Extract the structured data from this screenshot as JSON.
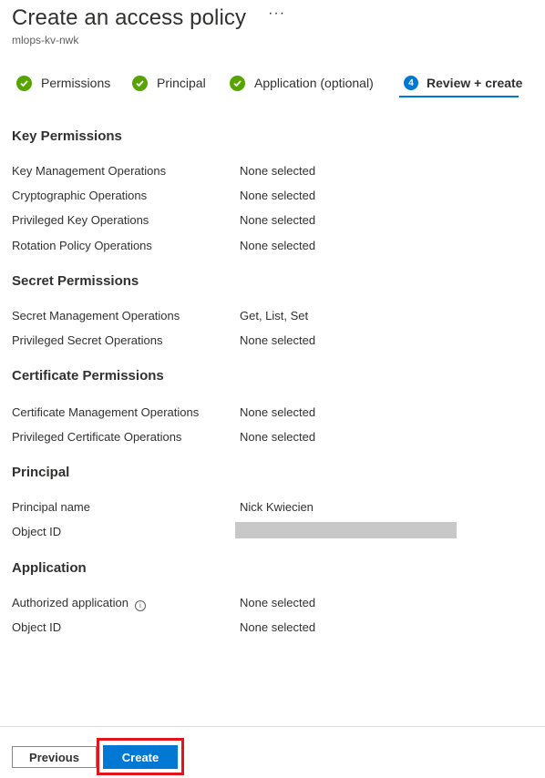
{
  "header": {
    "title": "Create an access policy",
    "more": "···",
    "subtitle": "mlops-kv-nwk"
  },
  "steps": [
    {
      "label": "Permissions",
      "state": "complete"
    },
    {
      "label": "Principal",
      "state": "complete"
    },
    {
      "label": "Application (optional)",
      "state": "complete"
    },
    {
      "label": "Review + create",
      "number": "4",
      "state": "active"
    }
  ],
  "sections": {
    "key": {
      "title": "Key Permissions",
      "rows": [
        {
          "label": "Key Management Operations",
          "value": "None selected"
        },
        {
          "label": "Cryptographic Operations",
          "value": "None selected"
        },
        {
          "label": "Privileged Key Operations",
          "value": "None selected"
        },
        {
          "label": "Rotation Policy Operations",
          "value": "None selected"
        }
      ]
    },
    "secret": {
      "title": "Secret Permissions",
      "rows": [
        {
          "label": "Secret Management Operations",
          "value": "Get, List, Set"
        },
        {
          "label": "Privileged Secret Operations",
          "value": "None selected"
        }
      ]
    },
    "certificate": {
      "title": "Certificate Permissions",
      "rows": [
        {
          "label": "Certificate Management Operations",
          "value": "None selected"
        },
        {
          "label": "Privileged Certificate Operations",
          "value": "None selected"
        }
      ]
    },
    "principal": {
      "title": "Principal",
      "rows": [
        {
          "label": "Principal name",
          "value": "Nick Kwiecien"
        },
        {
          "label": "Object ID",
          "value": ""
        }
      ]
    },
    "application": {
      "title": "Application",
      "rows": [
        {
          "label": "Authorized application",
          "value": "None selected"
        },
        {
          "label": "Object ID",
          "value": "None selected"
        }
      ]
    }
  },
  "footer": {
    "previous_label": "Previous",
    "create_label": "Create"
  },
  "colors": {
    "accent": "#0078d4",
    "success": "#57a300",
    "highlight": "#e3141c"
  },
  "icons": {
    "more": "ellipsis-icon",
    "complete": "check-circle-icon",
    "info": "info-icon"
  }
}
